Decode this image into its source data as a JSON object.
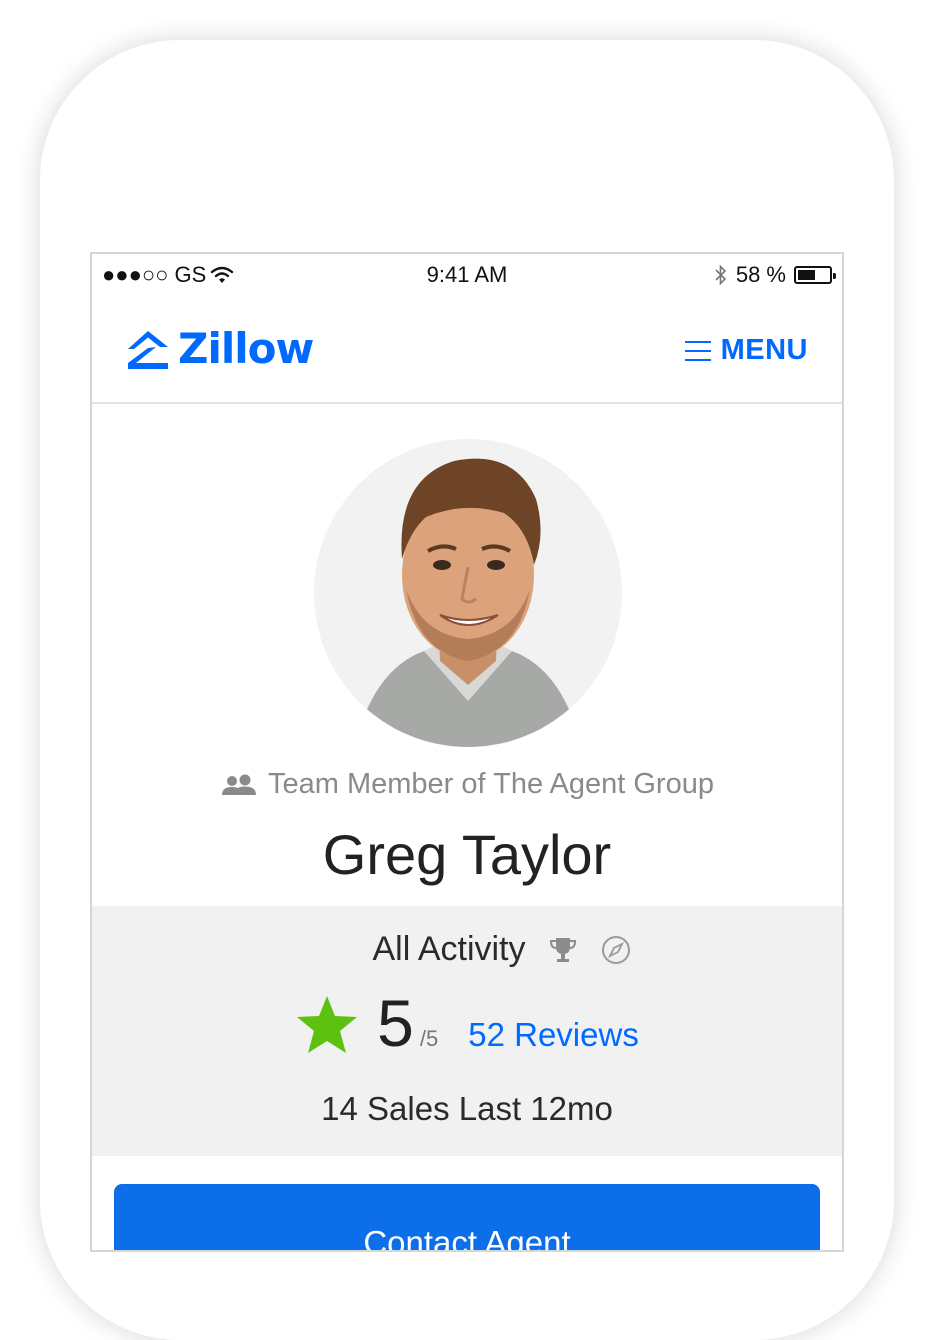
{
  "status_bar": {
    "carrier": "●●●○○ GS",
    "time": "9:41 AM",
    "battery_percent": "58 %",
    "battery_level": 0.58
  },
  "header": {
    "logo_text": "Zillow",
    "menu_label": "MENU"
  },
  "profile": {
    "team_text": "Team Member of The Agent Group",
    "name": "Greg Taylor"
  },
  "stats": {
    "activity_label": "All Activity",
    "rating_value": "5",
    "rating_scale": "/5",
    "reviews_label": "52 Reviews",
    "sales_text": "14 Sales Last 12mo"
  },
  "actions": {
    "contact_label": "Contact Agent"
  },
  "colors": {
    "brand_blue": "#006aff",
    "star_green": "#5cc10f",
    "stats_background": "#f1f1f1"
  },
  "icons": [
    "wifi-icon",
    "bluetooth-icon",
    "battery-icon",
    "zillow-logo-icon",
    "hamburger-icon",
    "team-icon",
    "trophy-icon",
    "compass-icon",
    "star-icon"
  ]
}
